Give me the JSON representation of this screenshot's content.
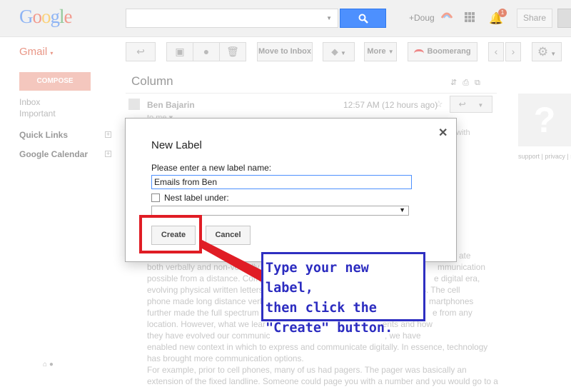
{
  "header": {
    "logo_letters": [
      {
        "ch": "G",
        "color": "#8eb4f4"
      },
      {
        "ch": "o",
        "color": "#f29a8e"
      },
      {
        "ch": "o",
        "color": "#fbd27a"
      },
      {
        "ch": "g",
        "color": "#8eb4f4"
      },
      {
        "ch": "l",
        "color": "#93c99a"
      },
      {
        "ch": "e",
        "color": "#f29a8e"
      }
    ],
    "user": "+Doug",
    "notification_count": "1",
    "share_label": "Share"
  },
  "app_menu": {
    "label": "Gmail",
    "caret": "▾"
  },
  "toolbar": {
    "back_icon": "↩",
    "archive_icon": "▣",
    "spam_icon": "●",
    "delete_icon": "🗑",
    "move_to_inbox_label": "Move to Inbox",
    "labels_icon": "⬥",
    "more_label": "More",
    "boomerang_label": "Boomerang",
    "prev_icon": "‹",
    "next_icon": "›",
    "settings_icon": "⚙"
  },
  "sidebar": {
    "compose_label": "COMPOSE",
    "items": [
      {
        "label": "Inbox"
      },
      {
        "label": "Important"
      }
    ],
    "quick_links_label": "Quick Links",
    "google_calendar_label": "Google Calendar",
    "plus_symbol": "+"
  },
  "message": {
    "subject": "Column",
    "sender": "Ben Bajarin",
    "time": "12:57 AM (12 hours ago)",
    "to": "to me ▾",
    "star": "☆",
    "reply_icon": "↩",
    "fragment_with": "with",
    "fragment_ate": "ate",
    "fragment_communication": "mmunication",
    "fragment_digital_era": "e digital era,",
    "fragment_the_cell": "s. The cell",
    "fragment_smartphones": "martphones",
    "fragment_from_any": "e from any",
    "body_lines": [
      "both verbally and non-verbally",
      "possible from a distance. Compo",
      "evolving physical written letters",
      "phone made long distance verba",
      "further made the full spectrum o",
      "location. However, what we lear                                                  ents and how",
      "they have evolved our communic                                                 , we have",
      "enabled new context in which to express and communicate digitally. In essence, technology",
      "has brought more communication options."
    ],
    "body_para2": [
      "For example, prior to cell phones, many of us had pagers. The pager was basically an",
      "extension of the fixed landline. Someone could page you with a number and you would go to a"
    ]
  },
  "right_panel": {
    "avatar_glyph": "?",
    "links": "support | privacy | re"
  },
  "dialog": {
    "title": "New Label",
    "close_icon": "✕",
    "prompt": "Please enter a new label name:",
    "name_value": "Emails from Ben",
    "nest_label": "Nest label under:",
    "select_arrow": "▼",
    "create_label": "Create",
    "cancel_label": "Cancel"
  },
  "annotation": {
    "callout_lines": [
      "Type your new label,",
      "then click the",
      "\"Create\" button."
    ],
    "highlight_color": "#e01d25",
    "callout_color": "#2e2fc1"
  }
}
